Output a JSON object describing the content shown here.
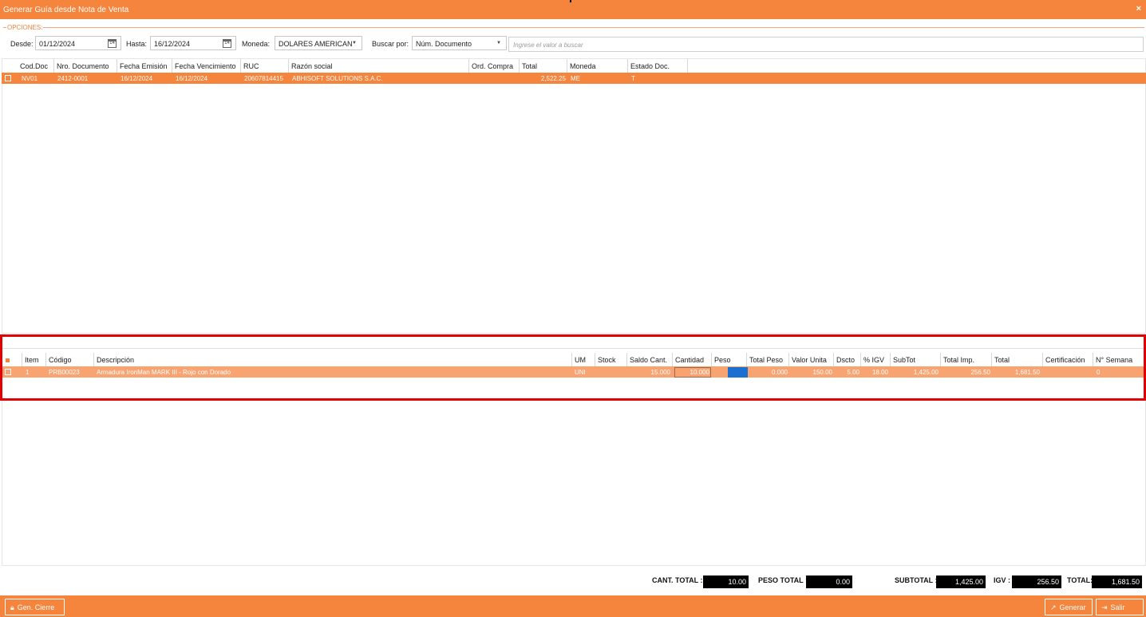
{
  "window": {
    "title": "Generar Guía desde Nota de Venta",
    "close": "×"
  },
  "options": {
    "legend": "OPCIONES:",
    "desde_label": "Desde:",
    "desde_value": "01/12/2024",
    "hasta_label": "Hasta:",
    "hasta_value": "16/12/2024",
    "moneda_label": "Moneda:",
    "moneda_value": "DOLARES AMERICAN",
    "buscar_label": "Buscar por:",
    "buscar_value": "Núm. Documento",
    "search_placeholder": "Ingrese el valor a buscar",
    "calendar_glyph": "14",
    "dropdown_glyph": "▼"
  },
  "documents": {
    "headers": [
      "Cod.Doc",
      "Nro. Documento",
      "Fecha Emisión",
      "Fecha Vencimiento",
      "RUC",
      "Razón social",
      "Ord. Compra",
      "Total",
      "Moneda",
      "Estado Doc."
    ],
    "rows": [
      {
        "cod": "NV01",
        "nro": "2412-0001",
        "emision": "16/12/2024",
        "vencimiento": "16/12/2024",
        "ruc": "20607814415",
        "razon": "ABHISOFT SOLUTIONS S.A.C.",
        "orden": "",
        "total": "2,522.25",
        "moneda": "ME",
        "estado": "T"
      }
    ]
  },
  "items": {
    "headers": [
      "Item",
      "Código",
      "Descripción",
      "UM",
      "Stock",
      "Saldo Cant.",
      "Cantidad",
      "Peso",
      "Total Peso",
      "Valor Unita",
      "Dscto",
      "% IGV",
      "SubTot",
      "Total Imp.",
      "Total",
      "Certificación",
      "N° Semana"
    ],
    "rows": [
      {
        "item": "1",
        "codigo": "PRB00023",
        "descripcion": "Armadura IronMan MARK III - Rojo con Dorado",
        "um": "UNI",
        "stock": "",
        "saldo": "15.000",
        "cantidad": "10.000",
        "peso": "",
        "total_peso": "0.000",
        "valor": "150.00",
        "dscto": "5.00",
        "igv": "18.00",
        "subtot": "1,425.00",
        "total_imp": "256.50",
        "total": "1,681.50",
        "cert": "",
        "semana": "0"
      }
    ]
  },
  "totals": {
    "cant_label": "CANT. TOTAL :",
    "cant_value": "10.00",
    "peso_label": "PESO TOTAL :",
    "peso_value": "0.00",
    "subtotal_label": "SUBTOTAL :",
    "subtotal_value": "1,425.00",
    "igv_label": "IGV :",
    "igv_value": "256.50",
    "total_label": "TOTAL:",
    "total_value": "1,681.50"
  },
  "footer": {
    "gen_cierre": "Gen. Cierre",
    "generar": "Generar",
    "salir": "Salir"
  },
  "colors": {
    "accent": "#f5843c",
    "row_selected": "#f9a371",
    "highlight": "#e50000"
  }
}
